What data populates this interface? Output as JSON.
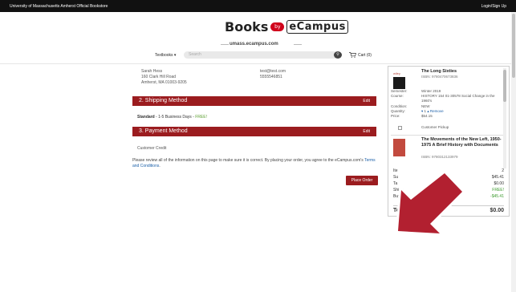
{
  "topbar": {
    "site": "University of Massachusetts Amherst Official Bookstore",
    "login": "Login/Sign Up"
  },
  "header": {
    "logo_books": "Books",
    "logo_by": "by",
    "logo_ecampus": "eCampus",
    "subdomain": "umass.ecampus.com",
    "textbooks_label": "Textbooks ▾",
    "search_placeholder": "Search",
    "cart_label": "Cart (0)"
  },
  "address": {
    "name": "Sarah Hess",
    "street": "160 Clark Hill Road",
    "city": "Amherst, MA 01003-9205"
  },
  "contact": {
    "email": "test@test.com",
    "phone": "5555546851"
  },
  "sections": {
    "shipping_title": "2. Shipping Method",
    "payment_title": "3. Payment Method",
    "edit_label": "Edit"
  },
  "shipping": {
    "method": "Standard",
    "days": " - 1-5 Business Days - ",
    "free": "FREE!"
  },
  "payment": {
    "method": "Customer Credit"
  },
  "review": {
    "text": "Please review all of the information on this page to make sure it is correct. By placing your order, you agree to the eCampus.com's ",
    "link": "Terms and Conditions",
    "end": "."
  },
  "place_order_label": "Place Order",
  "cart_items": [
    {
      "title": "The Long Sixties",
      "isbn": "ISBN: 9780470673836",
      "semester": "Winter 2019",
      "course": "HISTORY 154 01-30578 Social Change in the 1960's",
      "condition": "NEW",
      "quantity": "1",
      "remove": "Remove",
      "price": "$54.15",
      "pickup": "Customer Pickup",
      "thumb_logo": "wiley"
    },
    {
      "title": "The Movements of the New Left, 1950-1975 A Brief History with Documents",
      "isbn": "ISBN: 9780312133979"
    }
  ],
  "meta_labels": {
    "semester": "Semester:",
    "course": "Course:",
    "condition": "Condition:",
    "quantity": "Quantity:",
    "price": "Price:"
  },
  "summary": {
    "items_label": "Ite",
    "items_value": "2",
    "subtotal_label": "Su",
    "subtotal_value": "$45.41",
    "tax_label": "Ta",
    "tax_value": "$0.00",
    "shipping_label": "Shipp",
    "shipping_value": "FREE!",
    "buyback_label": "Buyback",
    "buyback_label_tail": "edit:",
    "buyback_value": "-$45.41",
    "total_label": "Total:",
    "total_value": "$0.00"
  },
  "colors": {
    "accent": "#9b1c1f",
    "link": "#1a5fa8",
    "free": "#3d9b2f",
    "annotation_arrow": "#b22030"
  }
}
